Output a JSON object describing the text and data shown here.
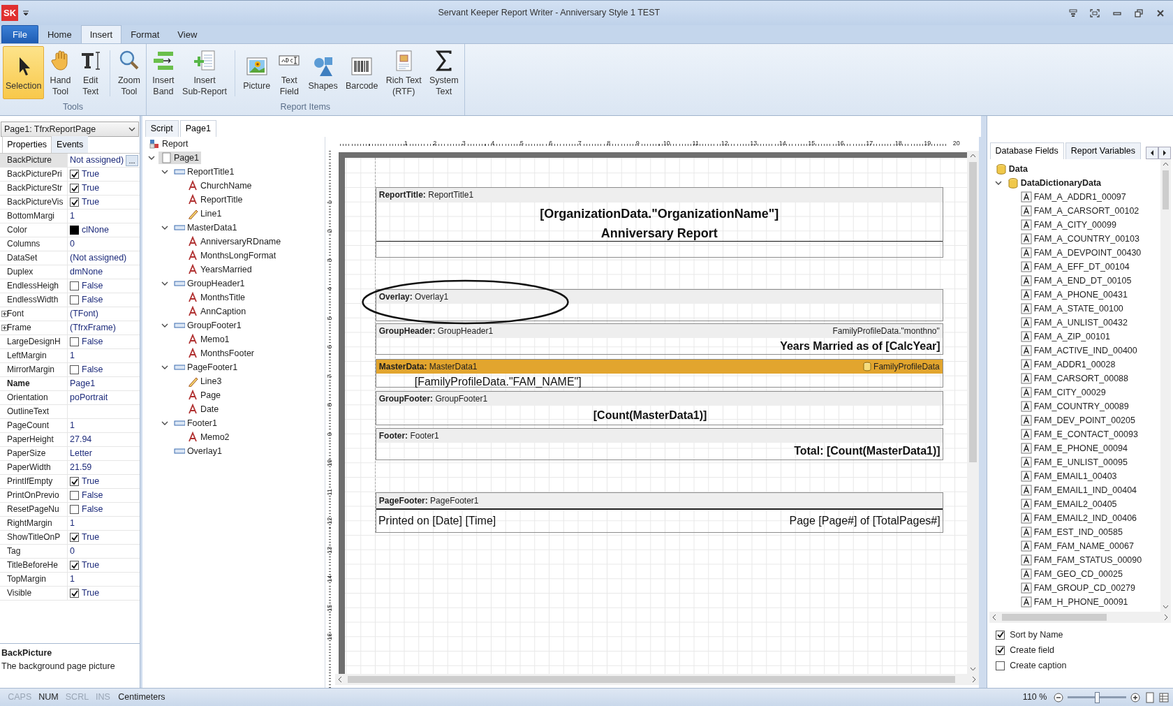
{
  "window": {
    "badge": "SK",
    "title": "Servant Keeper Report Writer - Anniversary Style 1 TEST"
  },
  "ribbon_tabs": [
    {
      "label": "File",
      "kind": "file",
      "selected": false
    },
    {
      "label": "Home",
      "kind": "tab",
      "selected": false
    },
    {
      "label": "Insert",
      "kind": "tab",
      "selected": true
    },
    {
      "label": "Format",
      "kind": "tab",
      "selected": false
    },
    {
      "label": "View",
      "kind": "tab",
      "selected": false
    }
  ],
  "ribbon_groups": [
    {
      "label": "Tools",
      "buttons": [
        {
          "label": "Selection",
          "selected": true
        },
        {
          "label": "Hand\nTool",
          "selected": false
        },
        {
          "label": "Edit\nText",
          "selected": false,
          "divider_after": true
        },
        {
          "label": "Zoom\nTool",
          "selected": false
        }
      ]
    },
    {
      "label": "Report Items",
      "buttons": [
        {
          "label": "Insert\nBand",
          "selected": false
        },
        {
          "label": "Insert\nSub-Report",
          "selected": false,
          "divider_after": true
        },
        {
          "label": "Picture",
          "selected": false
        },
        {
          "label": "Text\nField",
          "selected": false
        },
        {
          "label": "Shapes",
          "selected": false
        },
        {
          "label": "Barcode",
          "selected": false
        },
        {
          "label": "Rich Text\n(RTF)",
          "selected": false
        },
        {
          "label": "System\nText",
          "selected": false
        }
      ]
    }
  ],
  "object_selector": {
    "value": "Page1: TfrxReportPage"
  },
  "inspector_tabs": [
    {
      "label": "Properties",
      "selected": true
    },
    {
      "label": "Events",
      "selected": false
    }
  ],
  "properties": [
    {
      "name": "BackPicture",
      "kind": "ellipsis",
      "value": "Not assigned)",
      "button": "...",
      "selected": true
    },
    {
      "name": "BackPicturePri",
      "kind": "check",
      "checked": true,
      "value": "True",
      "selected": false
    },
    {
      "name": "BackPictureStr",
      "kind": "check",
      "checked": true,
      "value": "True",
      "selected": false
    },
    {
      "name": "BackPictureVis",
      "kind": "check",
      "checked": true,
      "value": "True",
      "selected": false
    },
    {
      "name": "BottomMargi",
      "kind": "text",
      "value": "1",
      "selected": false
    },
    {
      "name": "Color",
      "kind": "color",
      "color": "#000000",
      "value": "clNone",
      "selected": false
    },
    {
      "name": "Columns",
      "kind": "text",
      "value": "0",
      "selected": false
    },
    {
      "name": "DataSet",
      "kind": "text",
      "value": "(Not assigned)",
      "selected": false
    },
    {
      "name": "Duplex",
      "kind": "text",
      "value": "dmNone",
      "selected": false
    },
    {
      "name": "EndlessHeigh",
      "kind": "check",
      "checked": false,
      "value": "False",
      "selected": false
    },
    {
      "name": "EndlessWidth",
      "kind": "check",
      "checked": false,
      "value": "False",
      "selected": false
    },
    {
      "name": "Font",
      "kind": "expand",
      "expanded": false,
      "value": "(TFont)",
      "selected": false
    },
    {
      "name": "Frame",
      "kind": "expand",
      "expanded": false,
      "value": "(TfrxFrame)",
      "selected": false
    },
    {
      "name": "LargeDesignH",
      "kind": "check",
      "checked": false,
      "value": "False",
      "selected": false
    },
    {
      "name": "LeftMargin",
      "kind": "text",
      "value": "1",
      "selected": false
    },
    {
      "name": "MirrorMargin",
      "kind": "check",
      "checked": false,
      "value": "False",
      "selected": false
    },
    {
      "name": "Name",
      "kind": "name",
      "value": "Page1",
      "selected": false
    },
    {
      "name": "Orientation",
      "kind": "text",
      "value": "poPortrait",
      "selected": false
    },
    {
      "name": "OutlineText",
      "kind": "text",
      "selected": false
    },
    {
      "name": "PageCount",
      "kind": "text",
      "value": "1",
      "selected": false
    },
    {
      "name": "PaperHeight",
      "kind": "text",
      "value": "27.94",
      "selected": false
    },
    {
      "name": "PaperSize",
      "kind": "text",
      "value": "Letter",
      "selected": false
    },
    {
      "name": "PaperWidth",
      "kind": "text",
      "value": "21.59",
      "selected": false
    },
    {
      "name": "PrintIfEmpty",
      "kind": "check",
      "checked": true,
      "value": "True",
      "selected": false
    },
    {
      "name": "PrintOnPrevio",
      "kind": "check",
      "checked": false,
      "value": "False",
      "selected": false
    },
    {
      "name": "ResetPageNu",
      "kind": "check",
      "checked": false,
      "value": "False",
      "selected": false
    },
    {
      "name": "RightMargin",
      "kind": "text",
      "value": "1",
      "selected": false
    },
    {
      "name": "ShowTitleOnP",
      "kind": "check",
      "checked": true,
      "value": "True",
      "selected": false
    },
    {
      "name": "Tag",
      "kind": "text",
      "value": "0",
      "selected": false
    },
    {
      "name": "TitleBeforeHe",
      "kind": "check",
      "checked": true,
      "value": "True",
      "selected": false
    },
    {
      "name": "TopMargin",
      "kind": "text",
      "value": "1",
      "selected": false
    },
    {
      "name": "Visible",
      "kind": "check",
      "checked": true,
      "value": "True",
      "selected": false
    }
  ],
  "description": {
    "title": "BackPicture",
    "text": "The background page picture"
  },
  "designer_tabs": [
    {
      "label": "Script",
      "selected": false
    },
    {
      "label": "Page1",
      "selected": true
    }
  ],
  "report_tree": [
    {
      "label": "Report",
      "kind": "report",
      "selected": false
    },
    {
      "label": "Page1",
      "kind": "page",
      "selected": true,
      "expanded": true,
      "children": [
        {
          "label": "ReportTitle1",
          "kind": "band",
          "selected": false,
          "expanded": true,
          "children": [
            {
              "label": "ChurchName",
              "kind": "text",
              "selected": false
            },
            {
              "label": "ReportTitle",
              "kind": "text",
              "selected": false
            },
            {
              "label": "Line1",
              "kind": "line",
              "selected": false
            }
          ]
        },
        {
          "label": "MasterData1",
          "kind": "band",
          "selected": false,
          "expanded": true,
          "children": [
            {
              "label": "AnniversaryRDname",
              "kind": "text",
              "selected": false
            },
            {
              "label": "MonthsLongFormat",
              "kind": "text",
              "selected": false
            },
            {
              "label": "YearsMarried",
              "kind": "text",
              "selected": false
            }
          ]
        },
        {
          "label": "GroupHeader1",
          "kind": "band",
          "selected": false,
          "expanded": true,
          "children": [
            {
              "label": "MonthsTitle",
              "kind": "text",
              "selected": false
            },
            {
              "label": "AnnCaption",
              "kind": "text",
              "selected": false
            }
          ]
        },
        {
          "label": "GroupFooter1",
          "kind": "band",
          "selected": false,
          "expanded": true,
          "children": [
            {
              "label": "Memo1",
              "kind": "text",
              "selected": false
            },
            {
              "label": "MonthsFooter",
              "kind": "text",
              "selected": false
            }
          ]
        },
        {
          "label": "PageFooter1",
          "kind": "band",
          "selected": false,
          "expanded": true,
          "children": [
            {
              "label": "Line3",
              "kind": "line",
              "selected": false
            },
            {
              "label": "Page",
              "kind": "text",
              "selected": false
            },
            {
              "label": "Date",
              "kind": "text",
              "selected": false
            }
          ]
        },
        {
          "label": "Footer1",
          "kind": "band",
          "selected": false,
          "expanded": true,
          "children": [
            {
              "label": "Memo2",
              "kind": "text",
              "selected": false
            }
          ]
        },
        {
          "label": "Overlay1",
          "kind": "band",
          "selected": false
        }
      ]
    }
  ],
  "ruler": {
    "horizontal": [
      "1",
      "2",
      "3",
      "4",
      "5",
      "6",
      "7",
      "8",
      "9",
      "10",
      "11",
      "12",
      "13",
      "14",
      "15",
      "16",
      "17",
      "18",
      "19",
      "20"
    ],
    "vertical": [
      "1",
      "2",
      "3",
      "4",
      "5",
      "6",
      "7",
      "8",
      "9",
      "10",
      "11",
      "12",
      "13",
      "14",
      "15",
      "16"
    ]
  },
  "bands": [
    {
      "kind": "title",
      "caption": "**ReportTitle:** ReportTitle1",
      "selected": false,
      "texts": [
        "[OrganizationData.\"OrganizationName\"]",
        "Anniversary Report"
      ]
    },
    {
      "kind": "overlay",
      "caption": "**Overlay:** Overlay1",
      "selected": false
    },
    {
      "kind": "group_header",
      "caption": "**GroupHeader:** GroupHeader1",
      "selected": false,
      "right": "FamilyProfileData.\"monthno\"",
      "texts": [
        "Years Married as of [CalcYear]"
      ]
    },
    {
      "kind": "master_data",
      "caption": "**MasterData:** MasterData1",
      "selected": true,
      "right": "FamilyProfileData",
      "texts": [
        "[FamilyProfileData.\"FAM_NAME\"]"
      ]
    },
    {
      "kind": "group_footer",
      "caption": "**GroupFooter:** GroupFooter1",
      "selected": false,
      "texts": [
        "[Count(MasterData1)]"
      ]
    },
    {
      "kind": "footer",
      "caption": "**Footer:** Footer1",
      "selected": false,
      "texts": [
        "Total: [Count(MasterData1)]"
      ]
    },
    {
      "kind": "page_footer",
      "caption": "**PageFooter:** PageFooter1",
      "selected": false,
      "texts": [
        "Printed on [Date] [Time]",
        "Page [Page#] of [TotalPages#]"
      ]
    }
  ],
  "data_tabs": [
    {
      "label": "Database Fields",
      "selected": true
    },
    {
      "label": "Report Variables",
      "selected": false
    }
  ],
  "data_tree": [
    {
      "label": "Data",
      "kind": "database",
      "selected": false
    },
    {
      "label": "DataDictionaryData",
      "kind": "database",
      "selected": false,
      "expanded": true,
      "children": [
        {
          "label": "FAM_A_ADDR1_00097",
          "kind": "field",
          "selected": false
        },
        {
          "label": "FAM_A_CARSORT_00102",
          "kind": "field",
          "selected": false
        },
        {
          "label": "FAM_A_CITY_00099",
          "kind": "field",
          "selected": false
        },
        {
          "label": "FAM_A_COUNTRY_00103",
          "kind": "field",
          "selected": false
        },
        {
          "label": "FAM_A_DEVPOINT_00430",
          "kind": "field",
          "selected": false
        },
        {
          "label": "FAM_A_EFF_DT_00104",
          "kind": "field",
          "selected": false
        },
        {
          "label": "FAM_A_END_DT_00105",
          "kind": "field",
          "selected": false
        },
        {
          "label": "FAM_A_PHONE_00431",
          "kind": "field",
          "selected": false
        },
        {
          "label": "FAM_A_STATE_00100",
          "kind": "field",
          "selected": false
        },
        {
          "label": "FAM_A_UNLIST_00432",
          "kind": "field",
          "selected": false
        },
        {
          "label": "FAM_A_ZIP_00101",
          "kind": "field",
          "selected": false
        },
        {
          "label": "FAM_ACTIVE_IND_00400",
          "kind": "field",
          "selected": false
        },
        {
          "label": "FAM_ADDR1_00028",
          "kind": "field",
          "selected": false
        },
        {
          "label": "FAM_CARSORT_00088",
          "kind": "field",
          "selected": false
        },
        {
          "label": "FAM_CITY_00029",
          "kind": "field",
          "selected": false
        },
        {
          "label": "FAM_COUNTRY_00089",
          "kind": "field",
          "selected": false
        },
        {
          "label": "FAM_DEV_POINT_00205",
          "kind": "field",
          "selected": false
        },
        {
          "label": "FAM_E_CONTACT_00093",
          "kind": "field",
          "selected": false
        },
        {
          "label": "FAM_E_PHONE_00094",
          "kind": "field",
          "selected": false
        },
        {
          "label": "FAM_E_UNLIST_00095",
          "kind": "field",
          "selected": false
        },
        {
          "label": "FAM_EMAIL1_00403",
          "kind": "field",
          "selected": false
        },
        {
          "label": "FAM_EMAIL1_IND_00404",
          "kind": "field",
          "selected": false
        },
        {
          "label": "FAM_EMAIL2_00405",
          "kind": "field",
          "selected": false
        },
        {
          "label": "FAM_EMAIL2_IND_00406",
          "kind": "field",
          "selected": false
        },
        {
          "label": "FAM_EST_IND_00585",
          "kind": "field",
          "selected": false
        },
        {
          "label": "FAM_FAM_NAME_00067",
          "kind": "field",
          "selected": false
        },
        {
          "label": "FAM_FAM_STATUS_00090",
          "kind": "field",
          "selected": false
        },
        {
          "label": "FAM_GEO_CD_00025",
          "kind": "field",
          "selected": false
        },
        {
          "label": "FAM_GROUP_CD_00279",
          "kind": "field",
          "selected": false
        },
        {
          "label": "FAM_H_PHONE_00091",
          "kind": "field",
          "selected": false
        }
      ]
    }
  ],
  "data_options": [
    {
      "label": "Sort by Name",
      "checked": true
    },
    {
      "label": "Create field",
      "checked": true
    },
    {
      "label": "Create caption",
      "checked": false
    }
  ],
  "status_bar": {
    "indicators": [
      {
        "label": "CAPS",
        "on": false
      },
      {
        "label": "NUM",
        "on": true
      },
      {
        "label": "SCRL",
        "on": false
      },
      {
        "label": "INS",
        "on": false
      }
    ],
    "units": "Centimeters",
    "zoom": "110 %",
    "zoom_slider": {
      "level": 0.5
    }
  }
}
